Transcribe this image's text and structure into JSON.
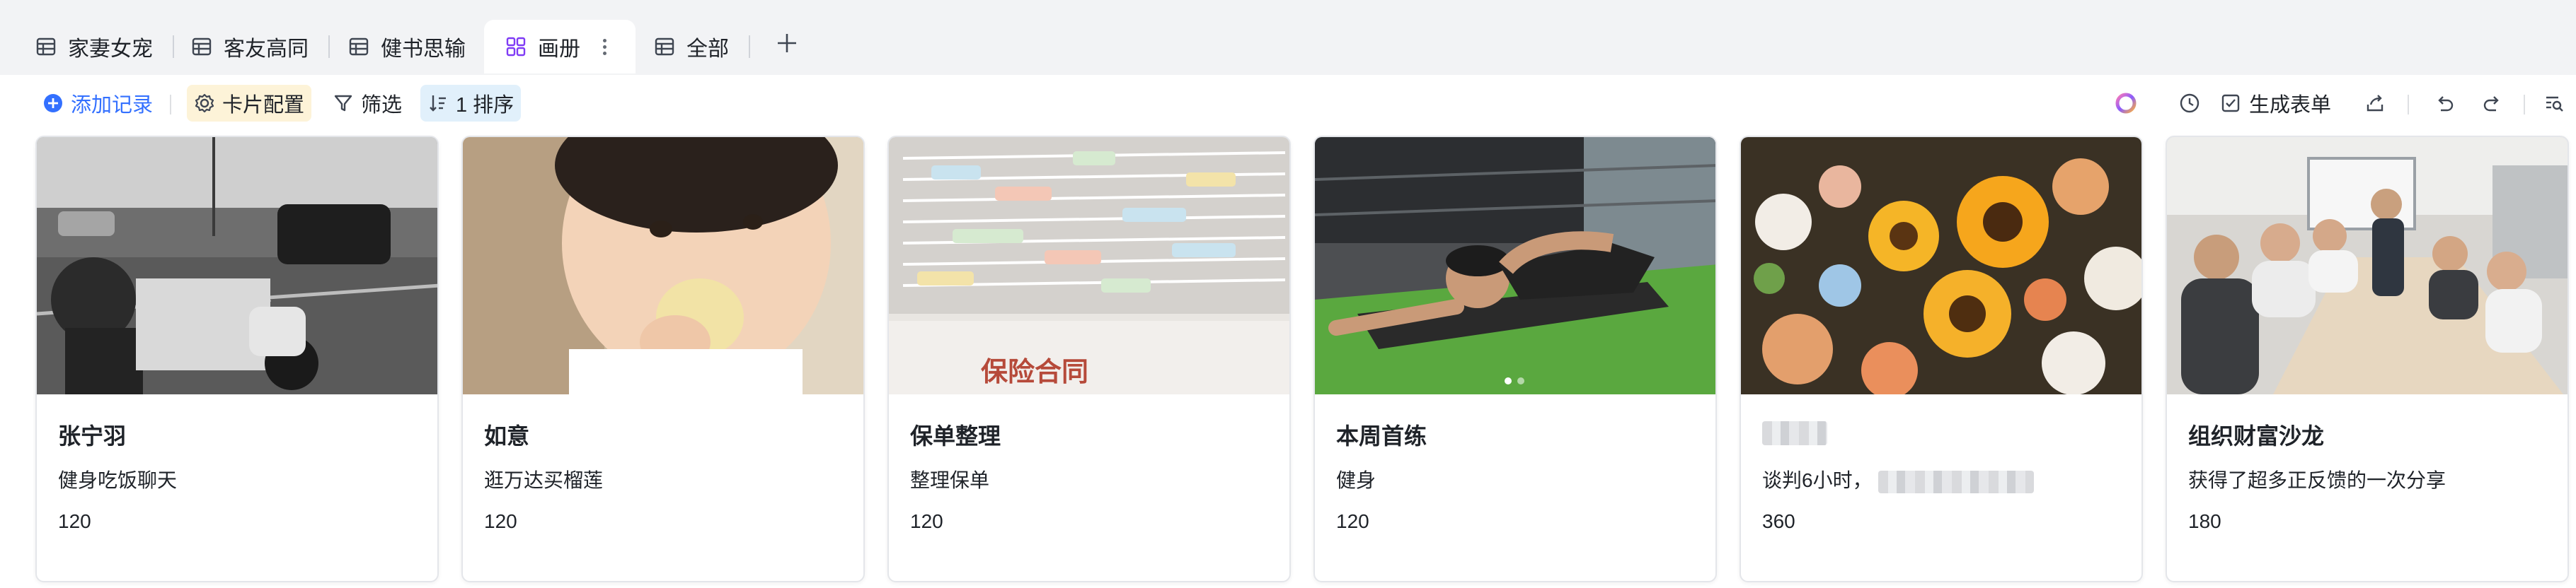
{
  "tabs": [
    {
      "label": "家妻女宠",
      "icon": "table-icon"
    },
    {
      "label": "客友高同",
      "icon": "table-icon"
    },
    {
      "label": "健书思输",
      "icon": "table-icon"
    },
    {
      "label": "画册",
      "icon": "gallery-icon",
      "active": true
    },
    {
      "label": "全部",
      "icon": "table-icon"
    }
  ],
  "toolbar": {
    "add_record": "添加记录",
    "card_config": "卡片配置",
    "filter": "筛选",
    "sort": "1 排序",
    "generate_form": "生成表单"
  },
  "colors": {
    "accent": "#3370ff",
    "active_tab_icon": "#7f3bf5",
    "card_config_bg": "#fdf3d8",
    "sort_bg": "#e1f0fb"
  },
  "cards": [
    {
      "title": "张宁羽",
      "desc": "健身吃饭聊天",
      "number": "120",
      "cover": "black-white street scene with scooter"
    },
    {
      "title": "如意",
      "desc": "逛万达买榴莲",
      "number": "120",
      "cover": "toddler eating durian"
    },
    {
      "title": "保单整理",
      "desc": "整理保单",
      "number": "120",
      "cover": "stack of insurance contracts with tabs"
    },
    {
      "title": "本周首练",
      "desc": "健身",
      "number": "120",
      "cover": "man doing push-up in gym"
    },
    {
      "title": "",
      "desc": "谈判6小时，",
      "number": "360",
      "cover": "sunflower bouquet"
    },
    {
      "title": "组织财富沙龙",
      "desc": "获得了超多正反馈的一次分享",
      "number": "180",
      "cover": "group photo in meeting room"
    }
  ]
}
